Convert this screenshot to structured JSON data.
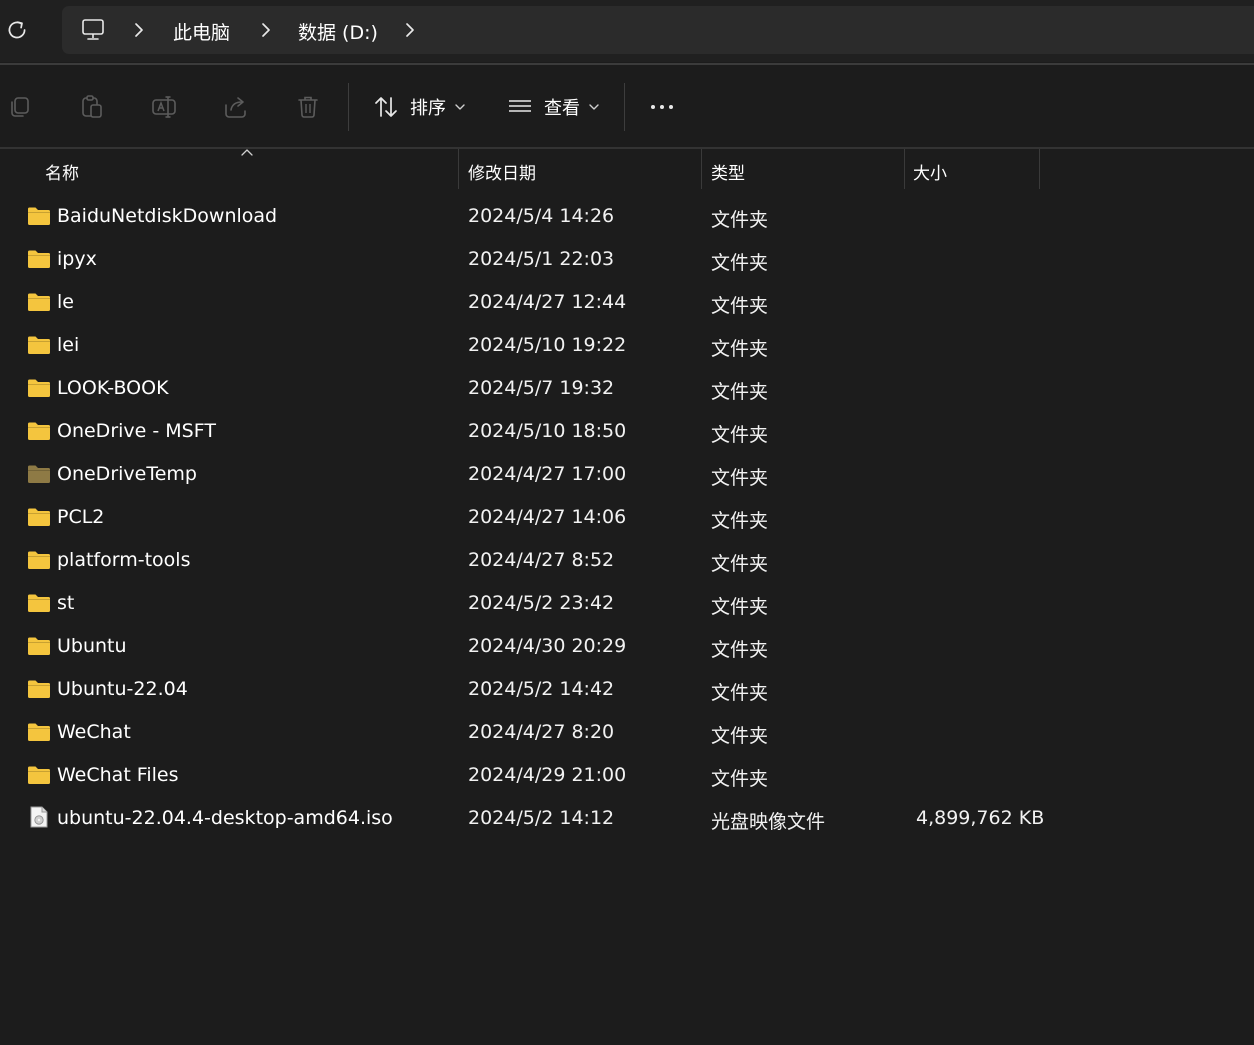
{
  "breadcrumb": {
    "items": [
      "此电脑",
      "数据 (D:)"
    ]
  },
  "toolbar": {
    "sort_label": "排序",
    "view_label": "查看",
    "more_label": "•••"
  },
  "columns": {
    "name": "名称",
    "modified": "修改日期",
    "type": "类型",
    "size": "大小"
  },
  "files": [
    {
      "name": "BaiduNetdiskDownload",
      "modified": "2024/5/4 14:26",
      "type": "文件夹",
      "size": "",
      "icon": "folder-icon"
    },
    {
      "name": "ipyx",
      "modified": "2024/5/1 22:03",
      "type": "文件夹",
      "size": "",
      "icon": "folder-icon"
    },
    {
      "name": "le",
      "modified": "2024/4/27 12:44",
      "type": "文件夹",
      "size": "",
      "icon": "folder-icon"
    },
    {
      "name": "lei",
      "modified": "2024/5/10 19:22",
      "type": "文件夹",
      "size": "",
      "icon": "folder-icon"
    },
    {
      "name": "LOOK-BOOK",
      "modified": "2024/5/7 19:32",
      "type": "文件夹",
      "size": "",
      "icon": "folder-icon"
    },
    {
      "name": "OneDrive - MSFT",
      "modified": "2024/5/10 18:50",
      "type": "文件夹",
      "size": "",
      "icon": "folder-icon"
    },
    {
      "name": "OneDriveTemp",
      "modified": "2024/4/27 17:00",
      "type": "文件夹",
      "size": "",
      "icon": "folder-hidden-icon"
    },
    {
      "name": "PCL2",
      "modified": "2024/4/27 14:06",
      "type": "文件夹",
      "size": "",
      "icon": "folder-icon"
    },
    {
      "name": "platform-tools",
      "modified": "2024/4/27 8:52",
      "type": "文件夹",
      "size": "",
      "icon": "folder-icon"
    },
    {
      "name": "st",
      "modified": "2024/5/2 23:42",
      "type": "文件夹",
      "size": "",
      "icon": "folder-icon"
    },
    {
      "name": "Ubuntu",
      "modified": "2024/4/30 20:29",
      "type": "文件夹",
      "size": "",
      "icon": "folder-icon"
    },
    {
      "name": "Ubuntu-22.04",
      "modified": "2024/5/2 14:42",
      "type": "文件夹",
      "size": "",
      "icon": "folder-icon"
    },
    {
      "name": "WeChat",
      "modified": "2024/4/27 8:20",
      "type": "文件夹",
      "size": "",
      "icon": "folder-icon"
    },
    {
      "name": "WeChat Files",
      "modified": "2024/4/29 21:00",
      "type": "文件夹",
      "size": "",
      "icon": "folder-icon"
    },
    {
      "name": "ubuntu-22.04.4-desktop-amd64.iso",
      "modified": "2024/5/2 14:12",
      "type": "光盘映像文件",
      "size": "4,899,762 KB",
      "icon": "disc-image-icon"
    }
  ],
  "colors": {
    "folder": "#f4c53e",
    "folder_hidden": "#8e7a45",
    "background": "#1c1c1c",
    "address_box": "#2b2b2b"
  }
}
